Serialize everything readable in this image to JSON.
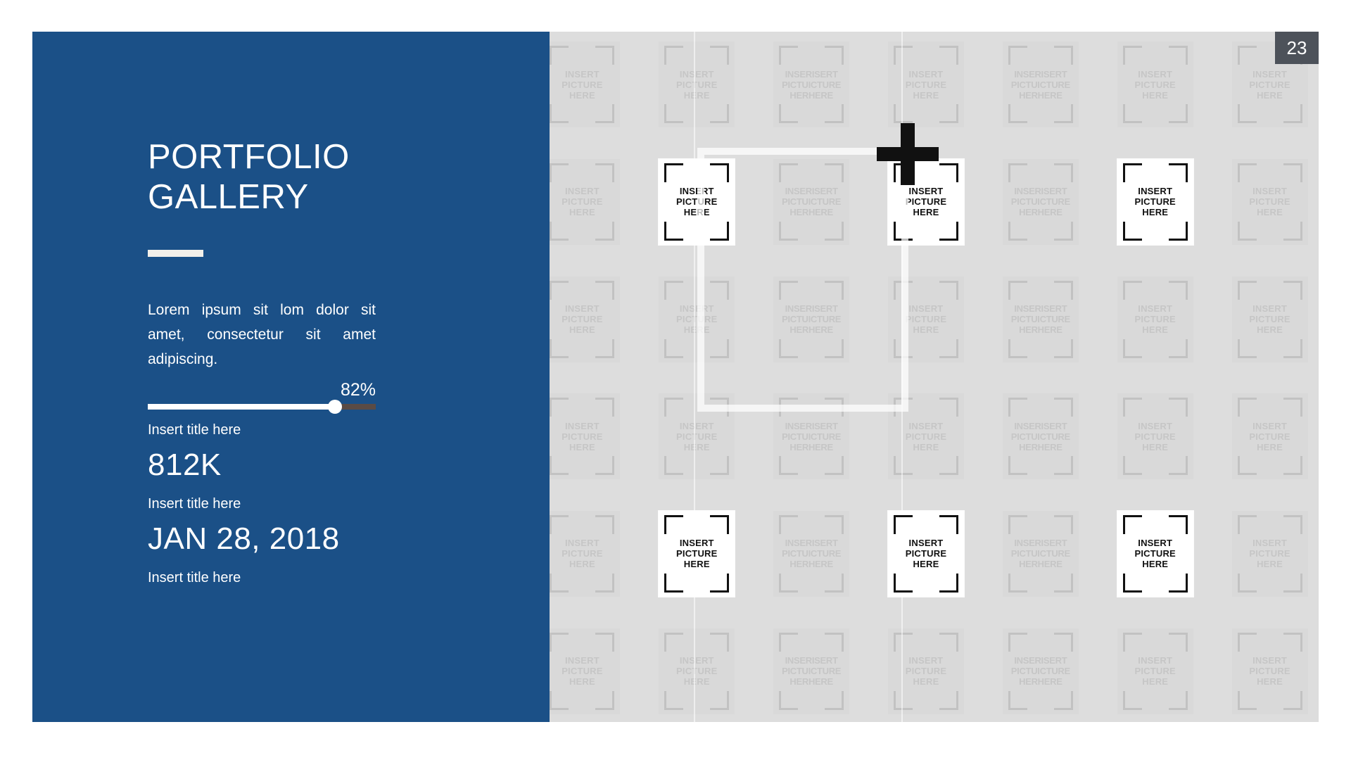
{
  "slide": {
    "page_number": "23",
    "background_color": "#dddddd",
    "panel_color": "#1b5087",
    "badge_color": "#4d525a"
  },
  "panel": {
    "title": "PORTFOLIO\nGALLERY",
    "body": "Lorem ipsum sit lom dolor sit amet, consectetur sit amet adipiscing.",
    "slider": {
      "value_label": "82%",
      "percent": 82,
      "caption": "Insert title here"
    },
    "stats": [
      {
        "value": "812K",
        "caption": "Insert title here"
      },
      {
        "value": "JAN 28, 2018",
        "caption": "Insert title here"
      }
    ]
  },
  "gallery": {
    "tile_caption": "INSERT\nPICTURE\nHERE",
    "tile_caption_doubled": "INSERISERT\nPICTUICTURE\nHERHERE",
    "rows": 6,
    "columns": 7,
    "highlighted_cells": [
      {
        "row": 2,
        "col": 2
      },
      {
        "row": 2,
        "col": 4
      },
      {
        "row": 2,
        "col": 6
      },
      {
        "row": 5,
        "col": 2
      },
      {
        "row": 5,
        "col": 4
      },
      {
        "row": 5,
        "col": 6
      }
    ],
    "doubled_columns": [
      3,
      5
    ],
    "plus_marker": "plus-marker",
    "selection_rect": "selection-rectangle"
  }
}
